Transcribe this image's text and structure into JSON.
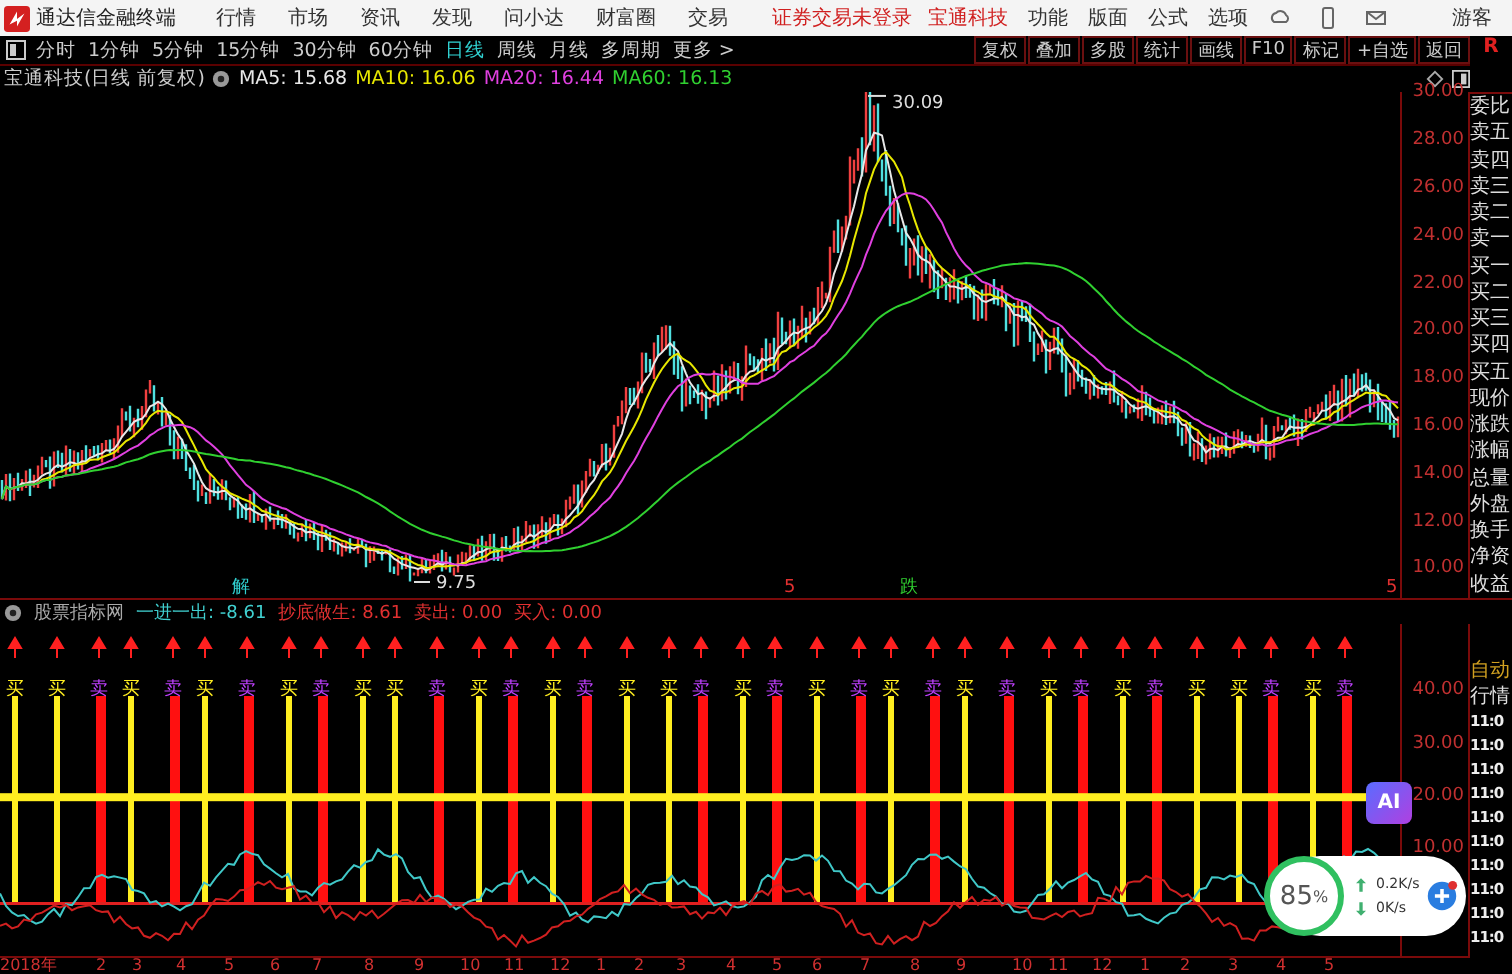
{
  "app_bar": {
    "title": "通达信金融终端",
    "menus": [
      "行情",
      "市场",
      "资讯",
      "发现",
      "问小达",
      "财富圈",
      "交易"
    ],
    "login_status": "证券交易未登录",
    "stock": "宝通科技",
    "right_menus": [
      "功能",
      "版面",
      "公式",
      "选项"
    ],
    "user": "游客"
  },
  "toolbar": {
    "periods": [
      {
        "label": "分时",
        "selected": false
      },
      {
        "label": "1分钟",
        "selected": false
      },
      {
        "label": "5分钟",
        "selected": false
      },
      {
        "label": "15分钟",
        "selected": false
      },
      {
        "label": "30分钟",
        "selected": false
      },
      {
        "label": "60分钟",
        "selected": false
      },
      {
        "label": "日线",
        "selected": true
      },
      {
        "label": "周线",
        "selected": false
      },
      {
        "label": "月线",
        "selected": false
      },
      {
        "label": "多周期",
        "selected": false
      },
      {
        "label": "更多 >",
        "selected": false
      }
    ],
    "tools": [
      "复权",
      "叠加",
      "多股",
      "统计",
      "画线",
      "F10",
      "标记",
      "+自选",
      "返回"
    ]
  },
  "chart": {
    "title": "宝通科技(日线 前复权)",
    "moving_averages": [
      {
        "label": "MA5:",
        "value": "15.68",
        "color": "#e8e8e8"
      },
      {
        "label": "MA10:",
        "value": "16.06",
        "color": "#e8e800"
      },
      {
        "label": "MA20:",
        "value": "16.44",
        "color": "#e040e0"
      },
      {
        "label": "MA60:",
        "value": "16.13",
        "color": "#30d030"
      }
    ],
    "high_label": "30.09",
    "low_label": "9.75",
    "markers": [
      {
        "label": "解",
        "kind": "info"
      },
      {
        "label": "5",
        "kind": "note"
      },
      {
        "label": "跌",
        "kind": "down"
      },
      {
        "label": "5",
        "kind": "note"
      }
    ],
    "y_ticks": [
      "30.00",
      "28.00",
      "26.00",
      "24.00",
      "22.00",
      "20.00",
      "18.00",
      "16.00",
      "14.00",
      "12.00",
      "10.00"
    ]
  },
  "indicator": {
    "name": "股票指标网",
    "readings": [
      {
        "label": "一进一出:",
        "value": "-8.61",
        "kind": "cyan"
      },
      {
        "label": "抄底做生:",
        "value": "8.61",
        "kind": "red"
      },
      {
        "label": "卖出:",
        "value": "0.00",
        "kind": "red"
      },
      {
        "label": "买入:",
        "value": "0.00",
        "kind": "red"
      }
    ],
    "y_ticks": [
      "40.00",
      "30.00",
      "20.00",
      "10.00"
    ],
    "signals": [
      {
        "kind": "buy",
        "label": "买"
      },
      {
        "kind": "buy",
        "label": "买"
      },
      {
        "kind": "sell",
        "label": "卖"
      },
      {
        "kind": "buy",
        "label": "买"
      },
      {
        "kind": "sell",
        "label": "卖"
      },
      {
        "kind": "buy",
        "label": "买"
      },
      {
        "kind": "sell",
        "label": "卖"
      },
      {
        "kind": "buy",
        "label": "买"
      },
      {
        "kind": "sell",
        "label": "卖"
      },
      {
        "kind": "buy",
        "label": "买"
      },
      {
        "kind": "buy",
        "label": "买"
      },
      {
        "kind": "sell",
        "label": "卖"
      },
      {
        "kind": "buy",
        "label": "买"
      },
      {
        "kind": "sell",
        "label": "卖"
      },
      {
        "kind": "buy",
        "label": "买"
      },
      {
        "kind": "sell",
        "label": "卖"
      },
      {
        "kind": "buy",
        "label": "买"
      },
      {
        "kind": "buy",
        "label": "买"
      },
      {
        "kind": "sell",
        "label": "卖"
      },
      {
        "kind": "buy",
        "label": "买"
      },
      {
        "kind": "sell",
        "label": "卖"
      },
      {
        "kind": "buy",
        "label": "买"
      },
      {
        "kind": "sell",
        "label": "卖"
      },
      {
        "kind": "buy",
        "label": "买"
      },
      {
        "kind": "sell",
        "label": "卖"
      },
      {
        "kind": "buy",
        "label": "买"
      },
      {
        "kind": "sell",
        "label": "卖"
      },
      {
        "kind": "buy",
        "label": "买"
      },
      {
        "kind": "sell",
        "label": "卖"
      },
      {
        "kind": "buy",
        "label": "买"
      },
      {
        "kind": "sell",
        "label": "卖"
      },
      {
        "kind": "buy",
        "label": "买"
      },
      {
        "kind": "buy",
        "label": "买"
      },
      {
        "kind": "sell",
        "label": "卖"
      },
      {
        "kind": "buy",
        "label": "买"
      },
      {
        "kind": "sell",
        "label": "卖"
      }
    ]
  },
  "date_axis": [
    "2018年",
    "2",
    "3",
    "4",
    "5",
    "6",
    "7",
    "8",
    "9",
    "10",
    "11",
    "12",
    "1",
    "2",
    "3",
    "4",
    "5",
    "6",
    "7",
    "8",
    "9",
    "10",
    "11",
    "12",
    "1",
    "2",
    "3",
    "4",
    "5"
  ],
  "side_panel": {
    "header": "R",
    "fields": [
      "委比",
      "卖五",
      "卖四",
      "卖三",
      "卖二",
      "卖一",
      "买一",
      "买二",
      "买三",
      "买四",
      "买五",
      "现价",
      "涨跌",
      "涨幅",
      "总量",
      "外盘",
      "换手",
      "净资",
      "收益"
    ],
    "mode": "自动",
    "quote": "行情",
    "times": [
      "11:0",
      "11:0",
      "11:0",
      "11:0",
      "11:0",
      "11:0",
      "11:0",
      "11:0",
      "11:0",
      "11:0"
    ]
  },
  "overlay": {
    "ai": "AI",
    "percent": "85",
    "percent_unit": "%",
    "upload": "0.2K/s",
    "download": "0K/s"
  }
}
